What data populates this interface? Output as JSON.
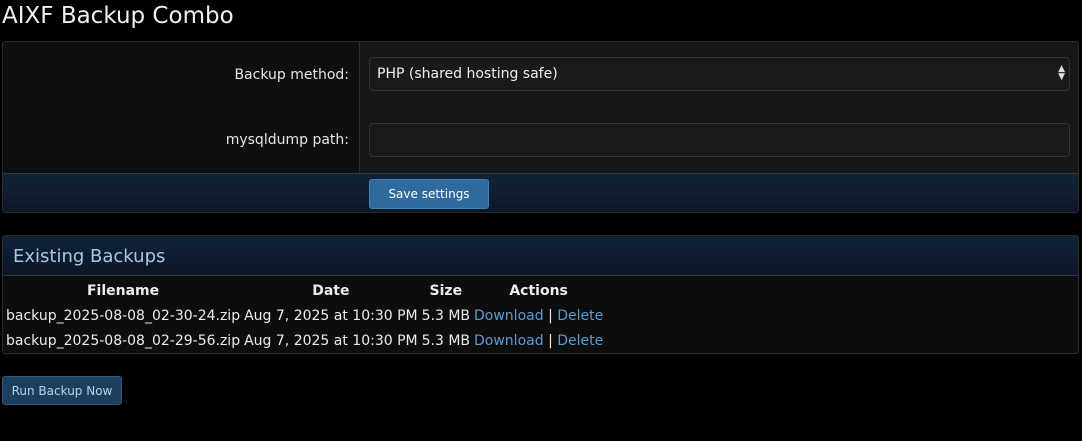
{
  "page": {
    "title": "AIXF Backup Combo"
  },
  "settings": {
    "method_label": "Backup method:",
    "method_value": "PHP (shared hosting safe)",
    "path_label": "mysqldump path:",
    "path_value": "",
    "save_label": "Save settings"
  },
  "backups": {
    "title": "Existing Backups",
    "columns": [
      "Filename",
      "Date",
      "Size",
      "Actions"
    ],
    "rows": [
      {
        "filename": "backup_2025-08-08_02-30-24.zip",
        "date": "Aug 7, 2025 at 10:30 PM",
        "size": "5.3 MB",
        "download": "Download",
        "separator": "|",
        "delete": "Delete"
      },
      {
        "filename": "backup_2025-08-08_02-29-56.zip",
        "date": "Aug 7, 2025 at 10:30 PM",
        "size": "5.3 MB",
        "download": "Download",
        "separator": "|",
        "delete": "Delete"
      }
    ]
  },
  "actions": {
    "run_label": "Run Backup Now"
  },
  "colors": {
    "background": "#000000",
    "panel": "#171717",
    "accent_button": "#2e6a9e",
    "link": "#5b9bd5",
    "header_text": "#a9c7e6"
  },
  "icons": {
    "select_arrow": "chevron-up-down-icon"
  }
}
